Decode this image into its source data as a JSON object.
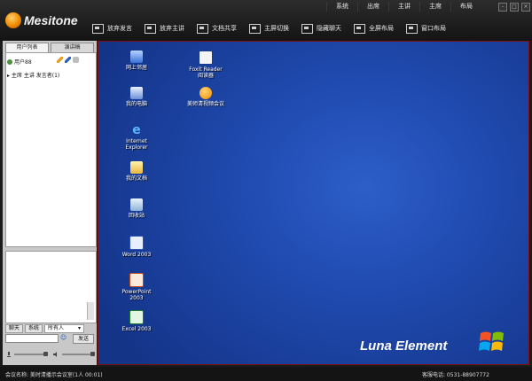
{
  "app": {
    "logo_text": "Mesitone"
  },
  "topmenu": [
    "系统",
    "出席",
    "主讲",
    "主席",
    "布局"
  ],
  "toolbar": [
    {
      "label": "放弃发言",
      "icon": "speaker-icon"
    },
    {
      "label": "放弃主讲",
      "icon": "presenter-icon"
    },
    {
      "label": "文档共享",
      "icon": "document-share-icon"
    },
    {
      "label": "主屏切换",
      "icon": "screen-switch-icon"
    },
    {
      "label": "隐藏聊天",
      "icon": "chat-hide-icon"
    },
    {
      "label": "全屏布局",
      "icon": "fullscreen-icon"
    },
    {
      "label": "窗口布局",
      "icon": "window-layout-icon"
    }
  ],
  "leftpanel": {
    "tabs": [
      "用户列表",
      "演讲稿"
    ],
    "user_label": "用户88",
    "tree_item": "主席 主讲 发言者(1)"
  },
  "chat": {
    "tabs": [
      "聊天",
      "系统"
    ],
    "recipient": "所有人",
    "send_label": "发送"
  },
  "desktop": {
    "icons": [
      {
        "label": "网上邻居",
        "icon": "network-icon"
      },
      {
        "label": "我的电脑",
        "icon": "computer-icon"
      },
      {
        "label": "Internet Explorer",
        "icon": "ie-icon"
      },
      {
        "label": "我的文档",
        "icon": "documents-icon"
      },
      {
        "label": "回收站",
        "icon": "recycle-bin-icon"
      },
      {
        "label": "Word 2003",
        "icon": "word-icon"
      },
      {
        "label": "PowerPoint 2003",
        "icon": "powerpoint-icon"
      },
      {
        "label": "Excel 2003",
        "icon": "excel-icon"
      },
      {
        "label": "Foxit Reader 阅读器",
        "icon": "foxit-icon"
      },
      {
        "label": "美师清视频会议",
        "icon": "meeting-icon"
      }
    ],
    "branding": "Luna Element"
  },
  "statusbar": {
    "meeting": "会议名称: 美时清播示会议室(1人 00:01)",
    "hotline": "客服电话: 0531-88907772"
  },
  "colors": {
    "desktop_blue": "#1f49ad",
    "border_red": "#7a1010",
    "logo_orange": "#f08c00"
  }
}
